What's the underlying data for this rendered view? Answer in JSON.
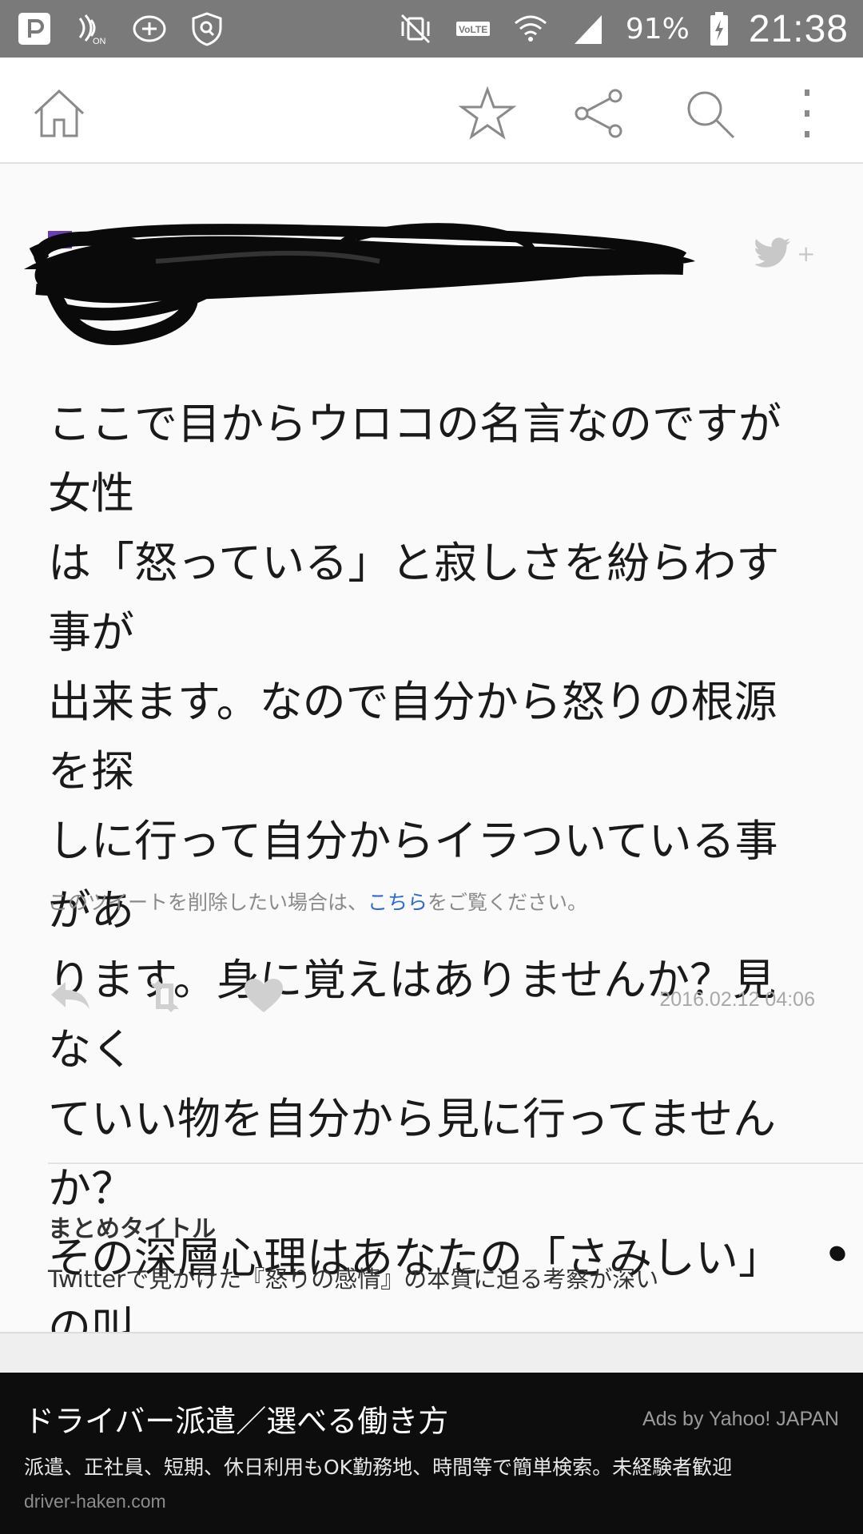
{
  "status_bar": {
    "battery_percent": "91%",
    "time": "21:38",
    "icons_left": [
      "app-p-icon",
      "nfc-on-icon",
      "add-circle-icon",
      "shield-icon"
    ],
    "icons_right": [
      "vibrate-mute-icon",
      "volte-icon",
      "wifi-icon",
      "signal-icon",
      "battery-charging-icon"
    ]
  },
  "toolbar": {
    "icons": [
      "home-icon",
      "star-icon",
      "share-icon",
      "search-icon",
      "more-vert-icon"
    ]
  },
  "tweet": {
    "text": "ここで目からウロコの名言なのですが女性\nは「怒っている」と寂しさを紛らわす事が\n出来ます。なので自分から怒りの根源を探\nしに行って自分からイラついている事があ\nります。身に覚えはありませんか？見なく\nていい物を自分から見に行ってませんか？\nその深層心理はあなたの「さみしい」の叫\nびです。",
    "date": "2016.02.12 04:06",
    "actions": [
      "reply-icon",
      "retweet-icon",
      "like-icon"
    ],
    "follow_icon": "twitter-follow-icon",
    "follow_plus": "+"
  },
  "delete_note": {
    "prefix": "このツイートを削除したい場合は、",
    "link": "こちら",
    "suffix": "をご覧ください。"
  },
  "summary": {
    "label": "まとめタイトル",
    "title": "Twitterで見かけた『怒りの感情』の本質に迫る考察が深い"
  },
  "ad": {
    "title": "ドライバー派遣／選べる働き方",
    "attribution": "Ads by Yahoo! JAPAN",
    "description": "派遣、正社員、短期、休日利用もOK勤務地、時間等で簡単検索。未経験者歓迎",
    "url": "driver-haken.com"
  },
  "colors": {
    "status_bar": "#7a7a7a",
    "link": "#2a6ad4",
    "ad_background": "#0d0d0d"
  }
}
